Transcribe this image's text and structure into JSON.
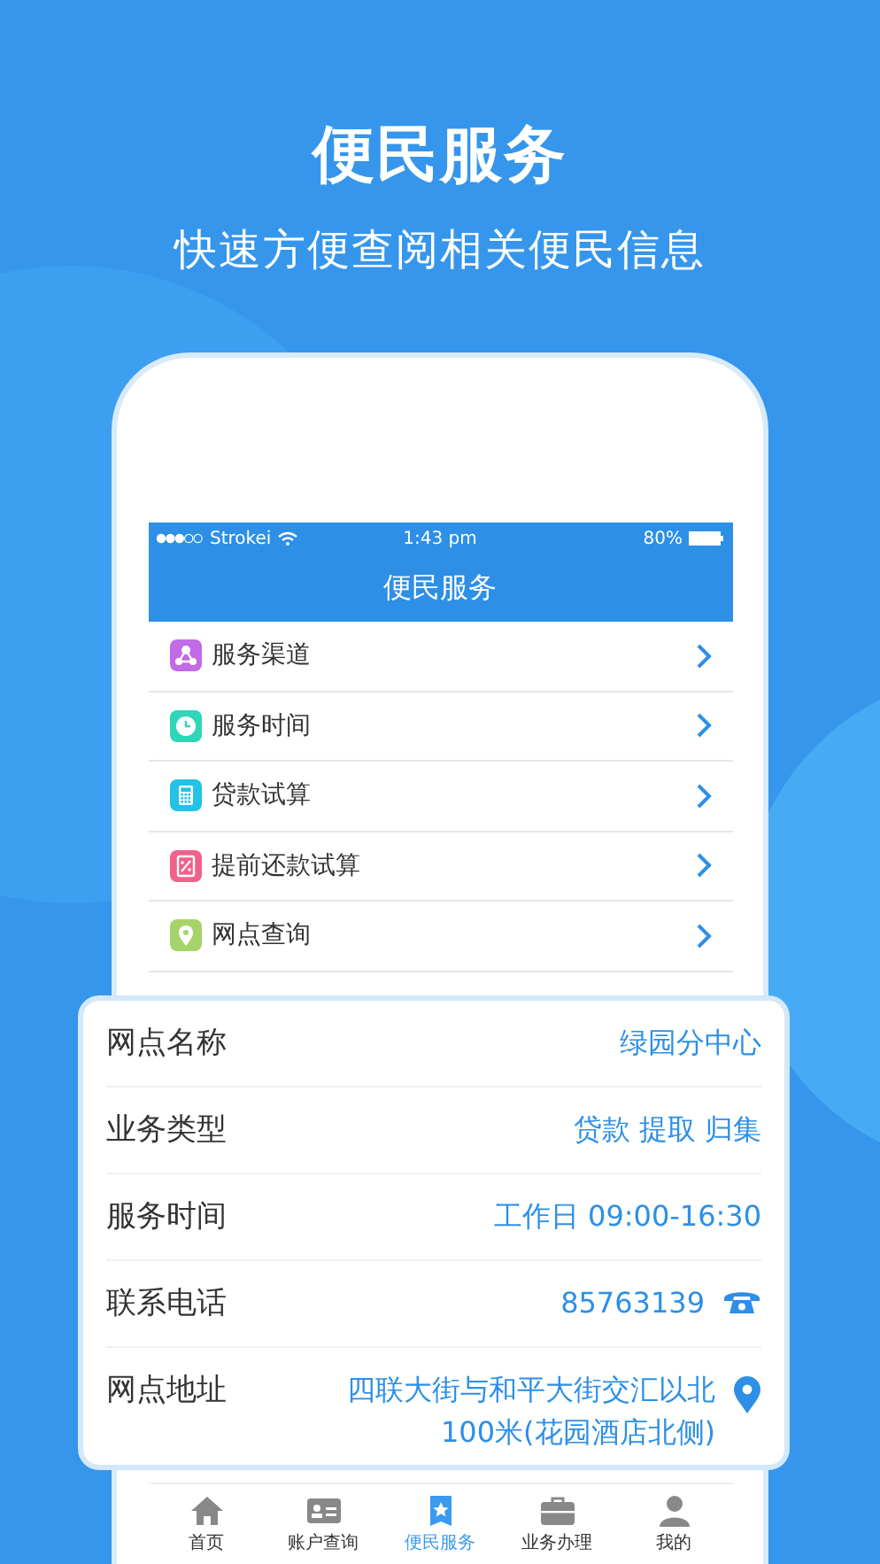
{
  "header": {
    "title": "便民服务",
    "subtitle": "快速方便查阅相关便民信息"
  },
  "status_bar": {
    "carrier": "Strokei",
    "time": "1:43 pm",
    "battery": "80%"
  },
  "nav": {
    "title": "便民服务"
  },
  "menu": [
    {
      "label": "服务渠道",
      "kind": "channels",
      "color": "#c36ae6"
    },
    {
      "label": "服务时间",
      "kind": "clock",
      "color": "#2fd6b8"
    },
    {
      "label": "贷款试算",
      "kind": "calculator",
      "color": "#22c3e6"
    },
    {
      "label": "提前还款试算",
      "kind": "repay",
      "color": "#f0628a"
    },
    {
      "label": "网点查询",
      "kind": "location",
      "color": "#a6d46a"
    }
  ],
  "detail": [
    {
      "label": "网点名称",
      "value": "绿园分中心",
      "kind": "text"
    },
    {
      "label": "业务类型",
      "value": "贷款 提取 归集",
      "kind": "text"
    },
    {
      "label": "服务时间",
      "value": "工作日 09:00-16:30",
      "kind": "text"
    },
    {
      "label": "联系电话",
      "value": "85763139",
      "kind": "phone"
    },
    {
      "label": "网点地址",
      "value": "四联大街与和平大街交汇以北100米(花园酒店北侧)",
      "kind": "location"
    }
  ],
  "tabs": [
    {
      "label": "首页",
      "kind": "home",
      "selected": false
    },
    {
      "label": "账户查询",
      "kind": "card",
      "selected": false
    },
    {
      "label": "便民服务",
      "kind": "star",
      "selected": true
    },
    {
      "label": "业务办理",
      "kind": "briefcase",
      "selected": false
    },
    {
      "label": "我的",
      "kind": "person",
      "selected": false
    }
  ]
}
